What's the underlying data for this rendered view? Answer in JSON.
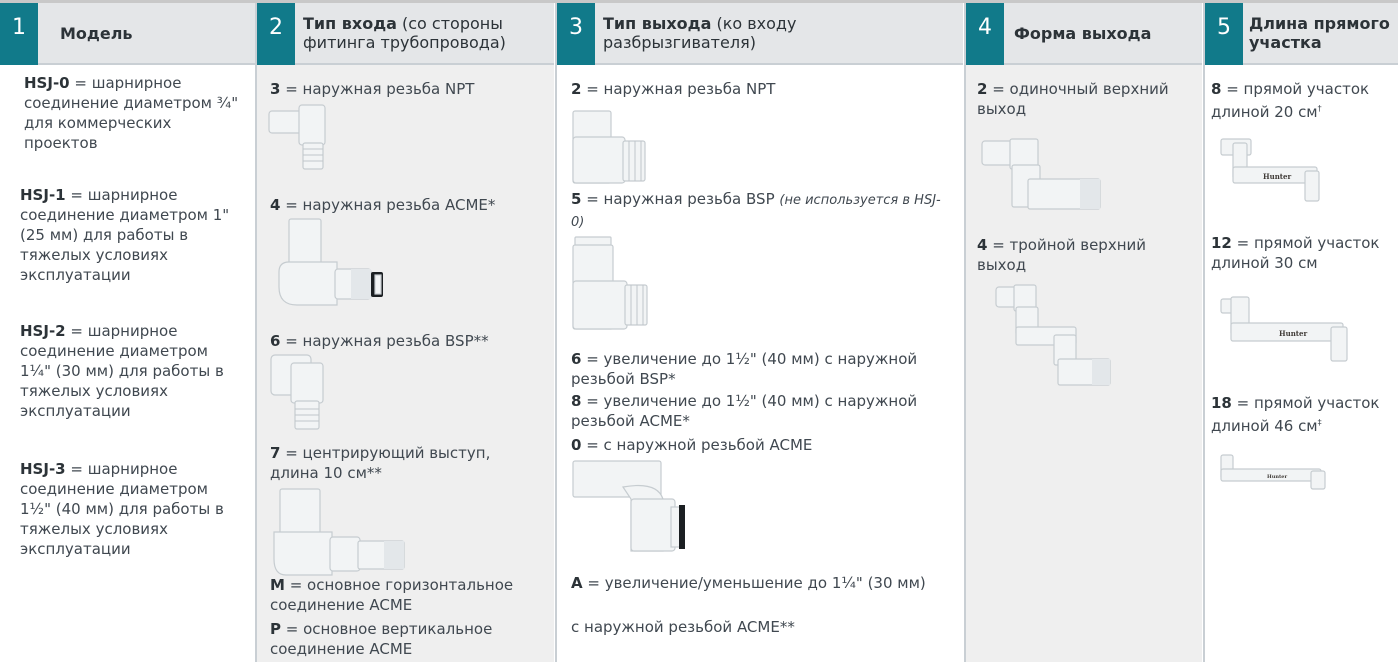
{
  "columns": [
    {
      "num": "1",
      "title": "Модель",
      "subtitle": ""
    },
    {
      "num": "2",
      "title": "Тип входа",
      "subtitle": " (со стороны фитинга трубопровода)"
    },
    {
      "num": "3",
      "title": "Тип выхода",
      "subtitle": " (ко входу разбрызгивателя)"
    },
    {
      "num": "4",
      "title": "Форма выхода",
      "subtitle": ""
    },
    {
      "num": "5",
      "title": "Длина прямого участка",
      "subtitle": ""
    }
  ],
  "models": [
    {
      "code": "HSJ-0",
      "desc": " = шарнирное соединение диаметром ¾\" для коммерческих проектов"
    },
    {
      "code": "HSJ-1",
      "desc": " = шарнирное соединение диаметром 1\" (25 мм) для работы в тяжелых  условиях эксплуатации"
    },
    {
      "code": "HSJ-2",
      "desc": " = шарнирное соединение диаметром 1¼\" (30 мм) для работы в тяжелых  условиях эксплуатации"
    },
    {
      "code": "HSJ-3",
      "desc": " = шарнирное соединение диаметром 1½\" (40 мм) для работы в тяжелых  условиях эксплуатации"
    }
  ],
  "inlet": [
    {
      "code": "3",
      "desc": " = наружная резьба NPT"
    },
    {
      "code": "4",
      "desc": " = наружная резьба ACME*"
    },
    {
      "code": "6",
      "desc": " = наружная резьба BSP**"
    },
    {
      "code": "7",
      "desc": " = центрирующий выступ, длина 10 см**"
    },
    {
      "code": "M",
      "desc": "  = основное горизонтальное соединение ACME"
    },
    {
      "code": "P",
      "desc": "  = основное вертикальное соединение ACME"
    }
  ],
  "outlet": [
    {
      "code": "2",
      "desc": " = наружная резьба NPT",
      "note": ""
    },
    {
      "code": "5",
      "desc": " = наружная резьба BSP ",
      "note": "(не используется в HSJ-0)"
    },
    {
      "code": "6",
      "desc": " = увеличение до 1½\" (40 мм) с наружной резьбой BSP*",
      "note": ""
    },
    {
      "code": "8",
      "desc": " = увеличение до 1½\" (40 мм) с наружной резьбой ACME*",
      "note": ""
    },
    {
      "code": "0",
      "desc": " = с наружной резьбой ACME",
      "note": ""
    },
    {
      "code": "A",
      "desc": " = увеличение/уменьшение до 1¼\" (30 мм)",
      "note": ""
    },
    {
      "code": "",
      "desc": "с наружной резьбой ACME**",
      "note": ""
    }
  ],
  "outlet_form": [
    {
      "code": "2",
      "desc": " = одиночный верхний выход"
    },
    {
      "code": "4",
      "desc": " = тройной верхний выход"
    }
  ],
  "length": [
    {
      "code": "8",
      "desc": " = прямой участок длиной 20 см",
      "mark": "†"
    },
    {
      "code": "12",
      "desc": "  = прямой участок длиной 30 см",
      "mark": ""
    },
    {
      "code": "18",
      "desc": " = прямой участок длиной 46 см",
      "mark": "‡"
    }
  ],
  "logo_text": "Hunter",
  "colors": {
    "badge": "#117a8a",
    "header_bg": "#e4e6e8",
    "shaded_col": "#efefef"
  }
}
